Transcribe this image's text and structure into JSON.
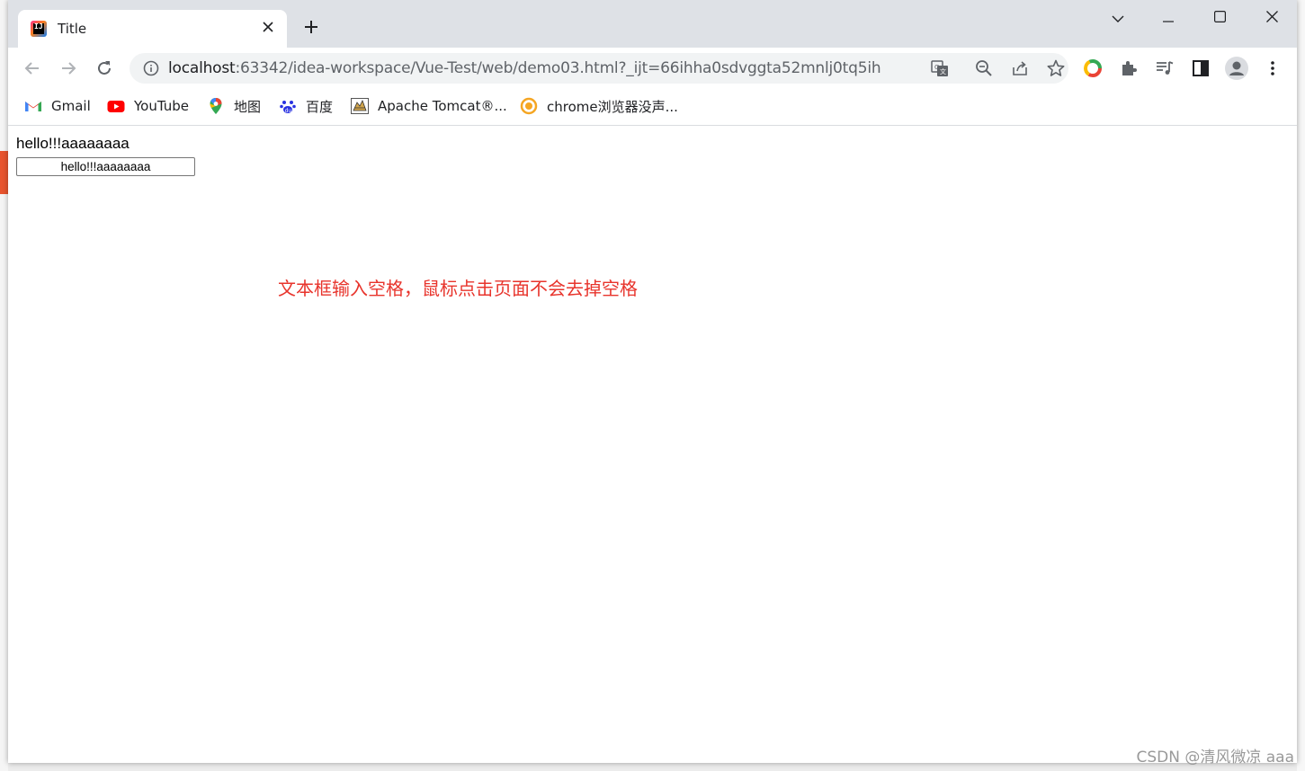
{
  "browser": {
    "tab": {
      "title": "Title",
      "favicon": "jetbrains-icon"
    },
    "new_tab_label": "+",
    "url": {
      "host": "localhost",
      "rest": ":63342/idea-workspace/Vue-Test/web/demo03.html?_ijt=66ihha0sdvggta52mnlj0tq5ih"
    },
    "bookmarks": [
      {
        "label": "Gmail",
        "icon": "gmail-icon"
      },
      {
        "label": "YouTube",
        "icon": "youtube-icon"
      },
      {
        "label": "地图",
        "icon": "maps-icon"
      },
      {
        "label": "百度",
        "icon": "baidu-icon"
      },
      {
        "label": "Apache Tomcat®...",
        "icon": "tomcat-icon"
      },
      {
        "label": "chrome浏览器没声...",
        "icon": "chrome-fix-icon"
      }
    ]
  },
  "page": {
    "message_text": "hello!!!aaaaaaaa",
    "input_value": "hello!!!aaaaaaaa",
    "note": "文本框输入空格，鼠标点击页面不会去掉空格"
  },
  "watermark": "CSDN @清风微凉 aaa",
  "colors": {
    "note": "#e8342c",
    "titlebar": "#dee1e6",
    "omnibox": "#f1f3f4"
  }
}
